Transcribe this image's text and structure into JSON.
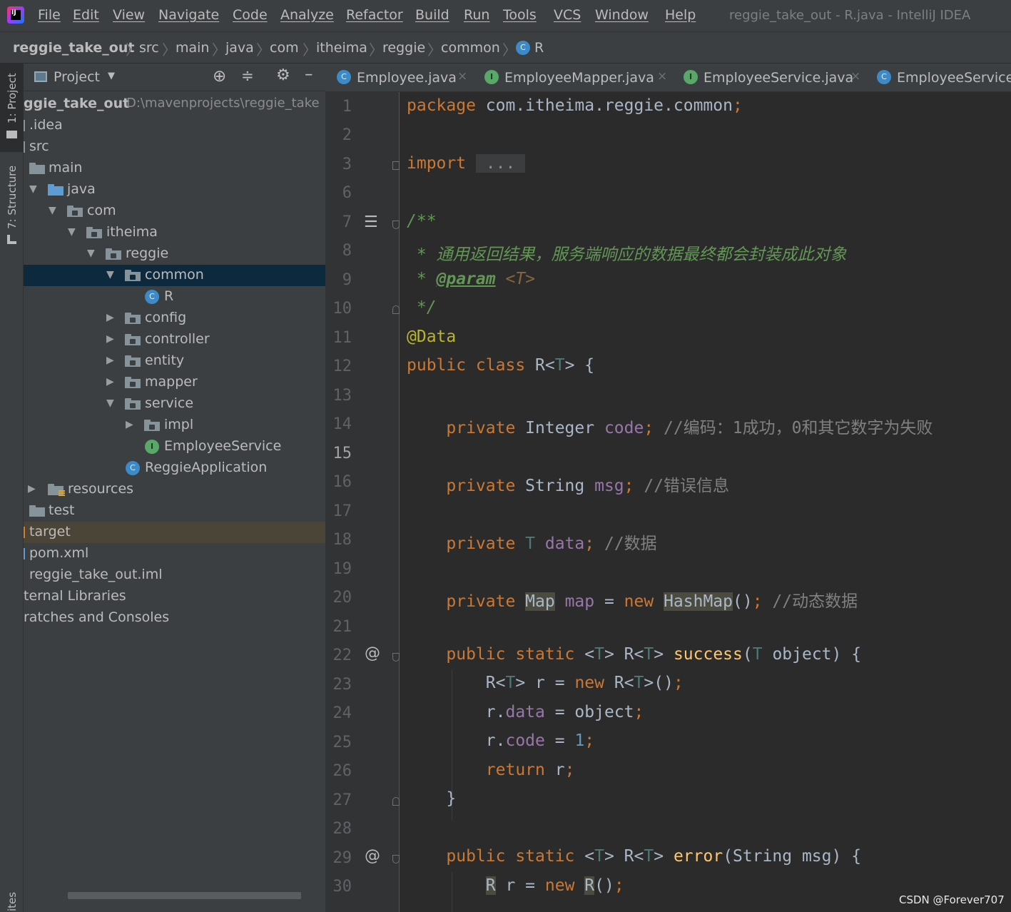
{
  "window": {
    "title": "reggie_take_out - R.java - IntelliJ IDEA"
  },
  "menu": [
    "File",
    "Edit",
    "View",
    "Navigate",
    "Code",
    "Analyze",
    "Refactor",
    "Build",
    "Run",
    "Tools",
    "VCS",
    "Window",
    "Help"
  ],
  "breadcrumb": [
    "reggie_take_out",
    "src",
    "main",
    "java",
    "com",
    "itheima",
    "reggie",
    "common",
    "R"
  ],
  "tool_windows": {
    "project": "1: Project",
    "structure": "7: Structure",
    "favorites": "ites"
  },
  "project_panel": {
    "title": "Project",
    "root_name": "ggie_take_out",
    "root_path": "D:\\mavenprojects\\reggie_take",
    "tree": [
      {
        "label": ".idea"
      },
      {
        "label": "src"
      },
      {
        "label": "main"
      },
      {
        "label": "java"
      },
      {
        "label": "com"
      },
      {
        "label": "itheima"
      },
      {
        "label": "reggie"
      },
      {
        "label": "common"
      },
      {
        "label": "R"
      },
      {
        "label": "config"
      },
      {
        "label": "controller"
      },
      {
        "label": "entity"
      },
      {
        "label": "mapper"
      },
      {
        "label": "service"
      },
      {
        "label": "impl"
      },
      {
        "label": "EmployeeService"
      },
      {
        "label": "ReggieApplication"
      },
      {
        "label": "resources"
      },
      {
        "label": "test"
      },
      {
        "label": "target"
      },
      {
        "label": "pom.xml"
      },
      {
        "label": "reggie_take_out.iml"
      },
      {
        "label": "ternal Libraries"
      },
      {
        "label": "ratches and Consoles"
      }
    ]
  },
  "tabs": [
    "Employee.java",
    "EmployeeMapper.java",
    "EmployeeService.java",
    "EmployeeServiceI"
  ],
  "code_lines": [
    "package com.itheima.reggie.common;",
    "",
    "import ...",
    "",
    "/**",
    " * 通用返回结果，服务端响应的数据最终都会封装成此对象",
    " * @param <T>",
    " */",
    "@Data",
    "public class R<T> {",
    "",
    "    private Integer code; //编码：1成功，0和其它数字为失败",
    "",
    "    private String msg; //错误信息",
    "",
    "    private T data; //数据",
    "",
    "    private Map map = new HashMap(); //动态数据",
    "",
    "    public static <T> R<T> success(T object) {",
    "        R<T> r = new R<T>();",
    "        r.data = object;",
    "        r.code = 1;",
    "        return r;",
    "    }",
    "",
    "    public static <T> R<T> error(String msg) {",
    "        R r = new R();"
  ],
  "line_numbers": [
    "1",
    "2",
    "3",
    "6",
    "7",
    "8",
    "9",
    "10",
    "11",
    "12",
    "13",
    "14",
    "15",
    "16",
    "17",
    "18",
    "19",
    "20",
    "21",
    "22",
    "23",
    "24",
    "25",
    "26",
    "27",
    "28",
    "29",
    "30"
  ],
  "current_line": "15",
  "watermark": "CSDN @Forever707",
  "colors": {
    "keyword": "#cc7832",
    "field": "#9876aa",
    "annotation": "#bbb529",
    "comment": "#808080",
    "doc": "#629755",
    "method": "#ffc66d",
    "number": "#6897bb",
    "selection": "#0d293e"
  }
}
